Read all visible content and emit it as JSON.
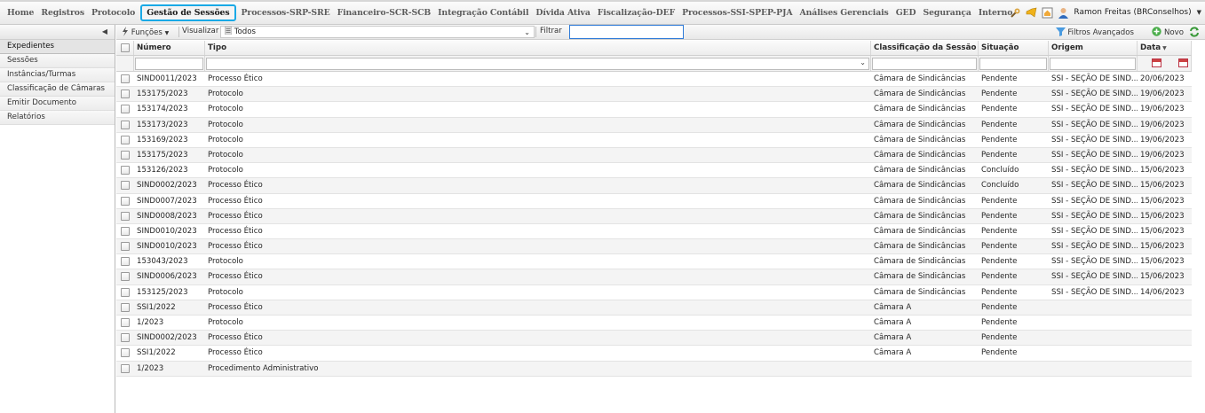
{
  "menu": [
    "Home",
    "Registros",
    "Protocolo",
    "Gestão de Sessões",
    "Processos-SRP-SRE",
    "Financeiro-SCR-SCB",
    "Integração Contábil",
    "Dívida Ativa",
    "Fiscalização-DEF",
    "Processos-SSI-SPEP-PJA",
    "Análises Gerenciais",
    "GED",
    "Segurança",
    "Interno"
  ],
  "active_menu": "Gestão de Sessões",
  "user": {
    "name": "Ramon Freitas (BRConselhos)"
  },
  "sidebar": {
    "items": [
      "Expedientes",
      "Sessões",
      "Instâncias/Turmas",
      "Classificação de Câmaras",
      "Emitir Documento",
      "Relatórios"
    ]
  },
  "toolbar": {
    "funcoes": "Funções",
    "visualizar": "Visualizar",
    "view_value": "Todos",
    "filtrar": "Filtrar",
    "filter_value": "",
    "adv_filters": "Filtros Avançados",
    "novo": "Novo"
  },
  "table": {
    "columns": [
      "Número",
      "Tipo",
      "Classificação da Sessão",
      "Situação",
      "Origem",
      "Data"
    ],
    "rows": [
      [
        "SIND0011/2023",
        "Processo Ético",
        "Câmara de Sindicâncias",
        "Pendente",
        "SSI - SEÇÃO DE SIND...",
        "20/06/2023"
      ],
      [
        "153175/2023",
        "Protocolo",
        "Câmara de Sindicâncias",
        "Pendente",
        "SSI - SEÇÃO DE SIND...",
        "19/06/2023"
      ],
      [
        "153174/2023",
        "Protocolo",
        "Câmara de Sindicâncias",
        "Pendente",
        "SSI - SEÇÃO DE SIND...",
        "19/06/2023"
      ],
      [
        "153173/2023",
        "Protocolo",
        "Câmara de Sindicâncias",
        "Pendente",
        "SSI - SEÇÃO DE SIND...",
        "19/06/2023"
      ],
      [
        "153169/2023",
        "Protocolo",
        "Câmara de Sindicâncias",
        "Pendente",
        "SSI - SEÇÃO DE SIND...",
        "19/06/2023"
      ],
      [
        "153175/2023",
        "Protocolo",
        "Câmara de Sindicâncias",
        "Pendente",
        "SSI - SEÇÃO DE SIND...",
        "19/06/2023"
      ],
      [
        "153126/2023",
        "Protocolo",
        "Câmara de Sindicâncias",
        "Concluído",
        "SSI - SEÇÃO DE SIND...",
        "15/06/2023"
      ],
      [
        "SIND0002/2023",
        "Processo Ético",
        "Câmara de Sindicâncias",
        "Concluído",
        "SSI - SEÇÃO DE SIND...",
        "15/06/2023"
      ],
      [
        "SIND0007/2023",
        "Processo Ético",
        "Câmara de Sindicâncias",
        "Pendente",
        "SSI - SEÇÃO DE SIND...",
        "15/06/2023"
      ],
      [
        "SIND0008/2023",
        "Processo Ético",
        "Câmara de Sindicâncias",
        "Pendente",
        "SSI - SEÇÃO DE SIND...",
        "15/06/2023"
      ],
      [
        "SIND0010/2023",
        "Processo Ético",
        "Câmara de Sindicâncias",
        "Pendente",
        "SSI - SEÇÃO DE SIND...",
        "15/06/2023"
      ],
      [
        "SIND0010/2023",
        "Processo Ético",
        "Câmara de Sindicâncias",
        "Pendente",
        "SSI - SEÇÃO DE SIND...",
        "15/06/2023"
      ],
      [
        "153043/2023",
        "Protocolo",
        "Câmara de Sindicâncias",
        "Pendente",
        "SSI - SEÇÃO DE SIND...",
        "15/06/2023"
      ],
      [
        "SIND0006/2023",
        "Processo Ético",
        "Câmara de Sindicâncias",
        "Pendente",
        "SSI - SEÇÃO DE SIND...",
        "15/06/2023"
      ],
      [
        "153125/2023",
        "Protocolo",
        "Câmara de Sindicâncias",
        "Pendente",
        "SSI - SEÇÃO DE SIND...",
        "14/06/2023"
      ],
      [
        "SSI1/2022",
        "Processo Ético",
        "Câmara A",
        "Pendente",
        "",
        ""
      ],
      [
        "1/2023",
        "Protocolo",
        "Câmara A",
        "Pendente",
        "",
        ""
      ],
      [
        "SIND0002/2023",
        "Processo Ético",
        "Câmara A",
        "Pendente",
        "",
        ""
      ],
      [
        "SSI1/2022",
        "Processo Ético",
        "Câmara A",
        "Pendente",
        "",
        ""
      ],
      [
        "1/2023",
        "Procedimento Administrativo",
        "",
        "",
        "",
        ""
      ]
    ]
  },
  "colors": {
    "active_menu_border": "#19a9e6",
    "filter_input_border": "#2f7bd8"
  }
}
